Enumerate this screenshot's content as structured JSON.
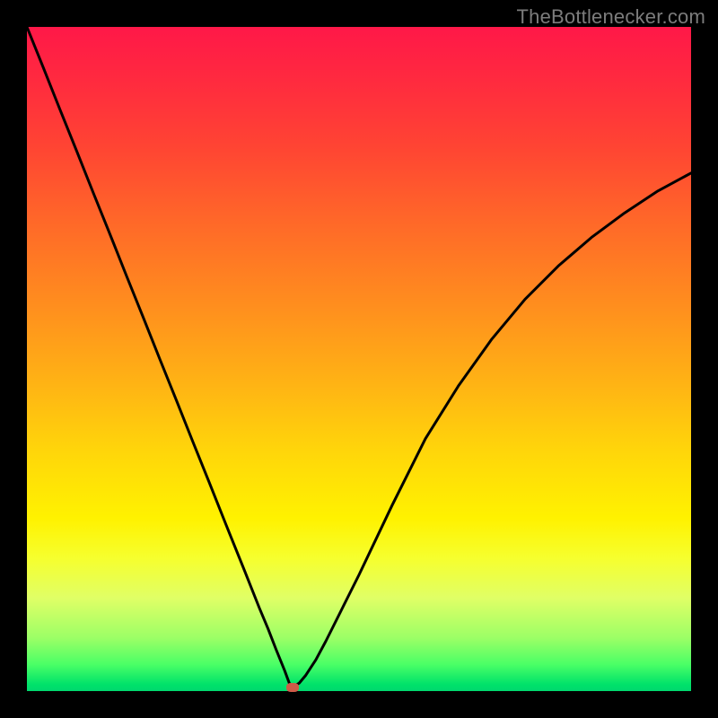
{
  "watermark": "TheBottlenecker.com",
  "colors": {
    "frame_bg": "#000000",
    "curve_stroke": "#000000",
    "marker_fill": "#cf5a48"
  },
  "chart_data": {
    "type": "line",
    "title": "",
    "xlabel": "",
    "ylabel": "",
    "xlim": [
      0,
      1
    ],
    "ylim": [
      0,
      1
    ],
    "x": [
      0.0,
      0.025,
      0.05,
      0.075,
      0.1,
      0.125,
      0.15,
      0.175,
      0.2,
      0.225,
      0.25,
      0.275,
      0.3,
      0.325,
      0.35,
      0.363,
      0.375,
      0.388,
      0.395,
      0.4,
      0.405,
      0.41,
      0.42,
      0.435,
      0.45,
      0.475,
      0.5,
      0.55,
      0.6,
      0.65,
      0.7,
      0.75,
      0.8,
      0.85,
      0.9,
      0.95,
      1.0
    ],
    "y": [
      1.0,
      0.938,
      0.875,
      0.813,
      0.75,
      0.688,
      0.625,
      0.563,
      0.5,
      0.438,
      0.375,
      0.313,
      0.25,
      0.188,
      0.125,
      0.094,
      0.063,
      0.031,
      0.012,
      0.006,
      0.009,
      0.012,
      0.024,
      0.047,
      0.075,
      0.125,
      0.175,
      0.28,
      0.38,
      0.46,
      0.53,
      0.59,
      0.64,
      0.683,
      0.72,
      0.753,
      0.78
    ],
    "minimum": {
      "x": 0.4,
      "y": 0.006
    },
    "annotations": []
  }
}
